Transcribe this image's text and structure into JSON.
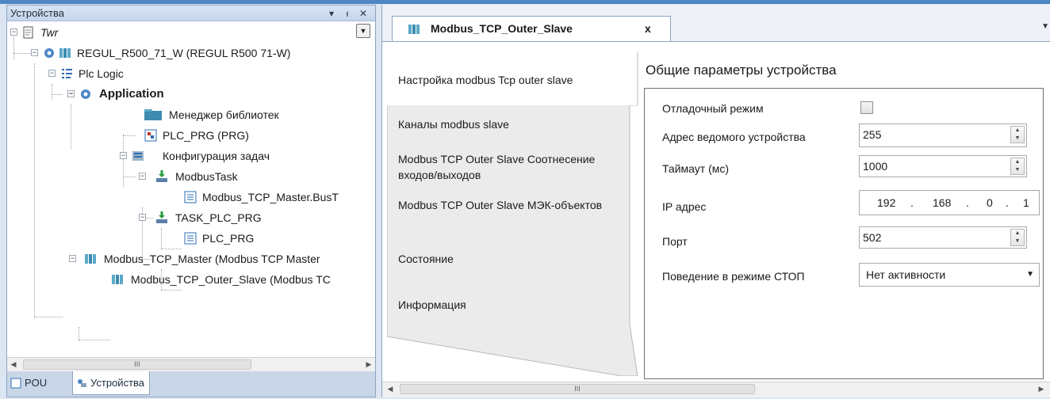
{
  "devices_pane": {
    "title": "Устройства",
    "header_buttons": [
      "▾",
      "ᵻ",
      "✕"
    ],
    "tree": [
      {
        "label": "Twr",
        "italic": true,
        "icon": "project-file-icon"
      },
      {
        "label": "REGUL_R500_71_W (REGUL R500 71-W)",
        "icon": "plc-device-icon"
      },
      {
        "label": "Plc Logic",
        "icon": "plc-logic-icon"
      },
      {
        "label": "Application",
        "bold": true,
        "icon": "application-gear-icon"
      },
      {
        "label": "Менеджер библиотек",
        "icon": "library-manager-icon"
      },
      {
        "label": "PLC_PRG (PRG)",
        "icon": "program-icon"
      },
      {
        "label": "Конфигурация задач",
        "icon": "task-config-icon"
      },
      {
        "label": "ModbusTask",
        "icon": "task-icon"
      },
      {
        "label": "Modbus_TCP_Master.BusT",
        "icon": "call-icon"
      },
      {
        "label": "TASK_PLC_PRG",
        "icon": "task-icon"
      },
      {
        "label": "PLC_PRG",
        "icon": "call-icon"
      },
      {
        "label": "Modbus_TCP_Master (Modbus TCP Master",
        "icon": "modbus-device-icon"
      },
      {
        "label": "Modbus_TCP_Outer_Slave (Modbus TC",
        "icon": "modbus-device-icon"
      }
    ],
    "scroll_thumb": "III",
    "bottom_tabs": [
      {
        "label": "POU",
        "icon": "pou-icon"
      },
      {
        "label": "Устройства",
        "icon": "devices-icon"
      }
    ]
  },
  "editor": {
    "tab_title": "Modbus_TCP_Outer_Slave",
    "tab_close": "x",
    "subtabs": [
      {
        "label": "Настройка modbus Tcp outer slave"
      },
      {
        "label": "Каналы modbus slave"
      },
      {
        "label": "Modbus TCP Outer Slave Соотнесение входов/выходов"
      },
      {
        "label": "Modbus TCP Outer Slave МЭК-объектов"
      },
      {
        "label": "Состояние"
      },
      {
        "label": "Информация"
      }
    ],
    "settings_title": "Общие параметры устройства",
    "params": {
      "debug_label": "Отладочный режим",
      "debug_checked": false,
      "slave_address_label": "Адрес ведомого устройства",
      "slave_address_value": "255",
      "timeout_label": "Таймаут (мс)",
      "timeout_value": "1000",
      "ip_label": "IP адрес",
      "ip_octets": [
        "192",
        "168",
        "0",
        "1"
      ],
      "port_label": "Порт",
      "port_value": "502",
      "stop_behavior_label": "Поведение в режиме СТОП",
      "stop_behavior_value": "Нет активности"
    },
    "scroll_thumb": "III"
  },
  "colors": {
    "accent": "#4f86c6",
    "pane_border": "#8da3c1",
    "background": "#dce6f2"
  }
}
